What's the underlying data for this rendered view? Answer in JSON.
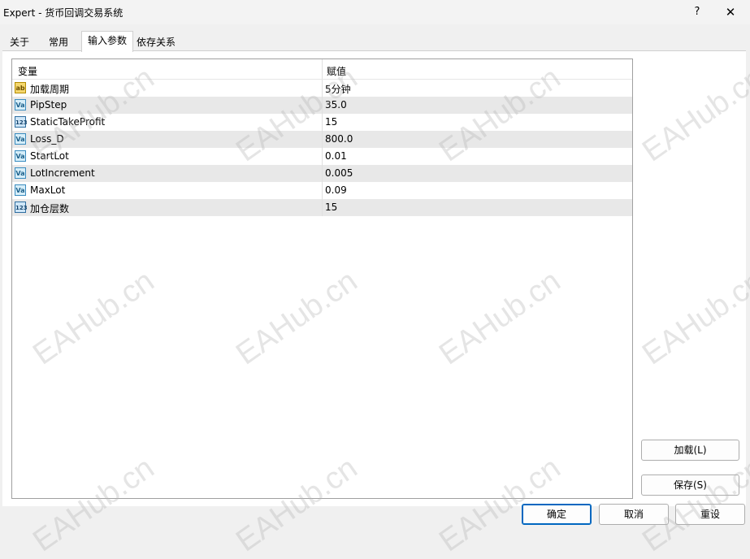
{
  "window": {
    "title": "Expert - 货币回调交易系统",
    "help_label": "?",
    "close_label": "✕"
  },
  "tabs": [
    {
      "label": "关于"
    },
    {
      "label": "常用"
    },
    {
      "label": "输入参数"
    },
    {
      "label": "依存关系"
    }
  ],
  "grid": {
    "headers": {
      "variable": "变量",
      "value": "赋值"
    },
    "rows": [
      {
        "icon": "ab",
        "name": "加载周期",
        "value": "5分钟"
      },
      {
        "icon": "Va",
        "name": "PipStep",
        "value": "35.0"
      },
      {
        "icon": "123",
        "name": "StaticTakeProfit",
        "value": "15"
      },
      {
        "icon": "Va",
        "name": "Loss_D",
        "value": "800.0"
      },
      {
        "icon": "Va",
        "name": "StartLot",
        "value": "0.01"
      },
      {
        "icon": "Va",
        "name": "LotIncrement",
        "value": "0.005"
      },
      {
        "icon": "Va",
        "name": "MaxLot",
        "value": "0.09"
      },
      {
        "icon": "123",
        "name": "加仓层数",
        "value": "15"
      }
    ]
  },
  "buttons": {
    "load": "加载(L)",
    "save": "保存(S)",
    "ok": "确定",
    "cancel": "取消",
    "reset": "重设"
  },
  "watermark": "EAHub.cn"
}
